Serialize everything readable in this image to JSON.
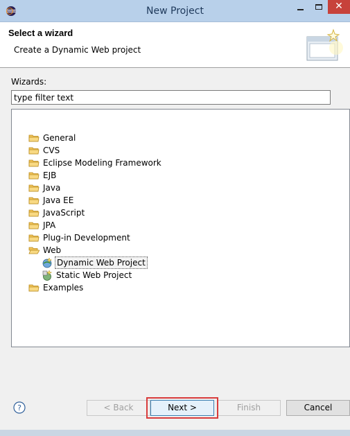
{
  "window": {
    "title": "New Project"
  },
  "header": {
    "title": "Select a wizard",
    "description": "Create a Dynamic Web project"
  },
  "wizards_label": "Wizards:",
  "filter": {
    "value": "type filter text"
  },
  "tree": {
    "items": [
      {
        "label": "General",
        "icon": "folder-icon"
      },
      {
        "label": "CVS",
        "icon": "folder-icon"
      },
      {
        "label": "Eclipse Modeling Framework",
        "icon": "folder-icon"
      },
      {
        "label": "EJB",
        "icon": "folder-icon"
      },
      {
        "label": "Java",
        "icon": "folder-icon"
      },
      {
        "label": "Java EE",
        "icon": "folder-icon"
      },
      {
        "label": "JavaScript",
        "icon": "folder-icon"
      },
      {
        "label": "JPA",
        "icon": "folder-icon"
      },
      {
        "label": "Plug-in Development",
        "icon": "folder-icon"
      },
      {
        "label": "Web",
        "icon": "open-folder-icon"
      },
      {
        "label": "Dynamic Web Project",
        "icon": "dynamic-web-project-icon",
        "selected": true
      },
      {
        "label": "Static Web Project",
        "icon": "static-web-project-icon"
      },
      {
        "label": "Examples",
        "icon": "folder-icon"
      }
    ]
  },
  "buttons": {
    "back": "< Back",
    "next": "Next >",
    "finish": "Finish",
    "cancel": "Cancel"
  },
  "colors": {
    "highlight": "#d83b3b",
    "titlebar": "#b8d0ea",
    "close": "#c7423b"
  }
}
